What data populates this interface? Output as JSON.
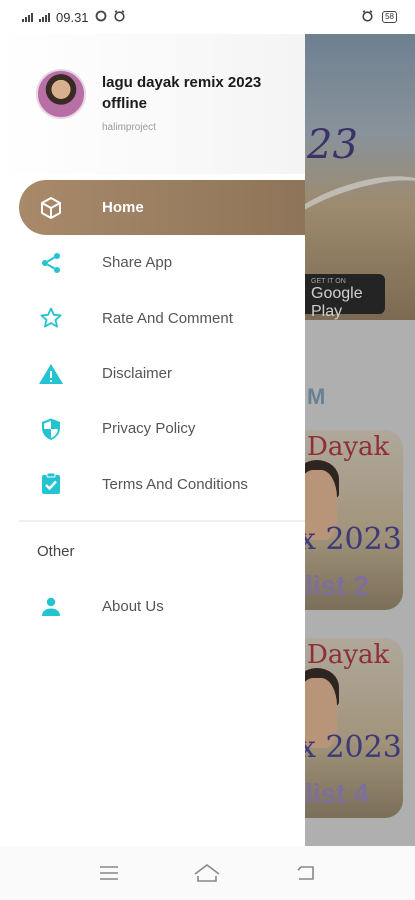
{
  "status": {
    "time": "09.31",
    "battery": "58"
  },
  "drawer": {
    "app_name": "lagu dayak remix 2023 offline",
    "developer": "halimproject",
    "items": [
      {
        "label": "Home",
        "icon": "cube-icon",
        "active": true
      },
      {
        "label": "Share App",
        "icon": "share-icon"
      },
      {
        "label": "Rate And Comment",
        "icon": "star-icon"
      },
      {
        "label": "Disclaimer",
        "icon": "warning-icon"
      },
      {
        "label": "Privacy Policy",
        "icon": "shield-icon"
      },
      {
        "label": "Terms And Conditions",
        "icon": "clipboard-check-icon"
      }
    ],
    "section_other": "Other",
    "about_label": "About Us"
  },
  "background": {
    "banner_text": "23",
    "store_small": "GET IT ON",
    "store_badge": "Google Play",
    "section_title": "M",
    "cards": [
      {
        "top": "Dayak",
        "mid": "x 2023",
        "bottom": "list 2"
      },
      {
        "top": "Dayak",
        "mid": "x 2023",
        "bottom": "list 4"
      }
    ]
  },
  "colors": {
    "accent": "#23c4cf",
    "active_bg": "#9a7f62"
  }
}
